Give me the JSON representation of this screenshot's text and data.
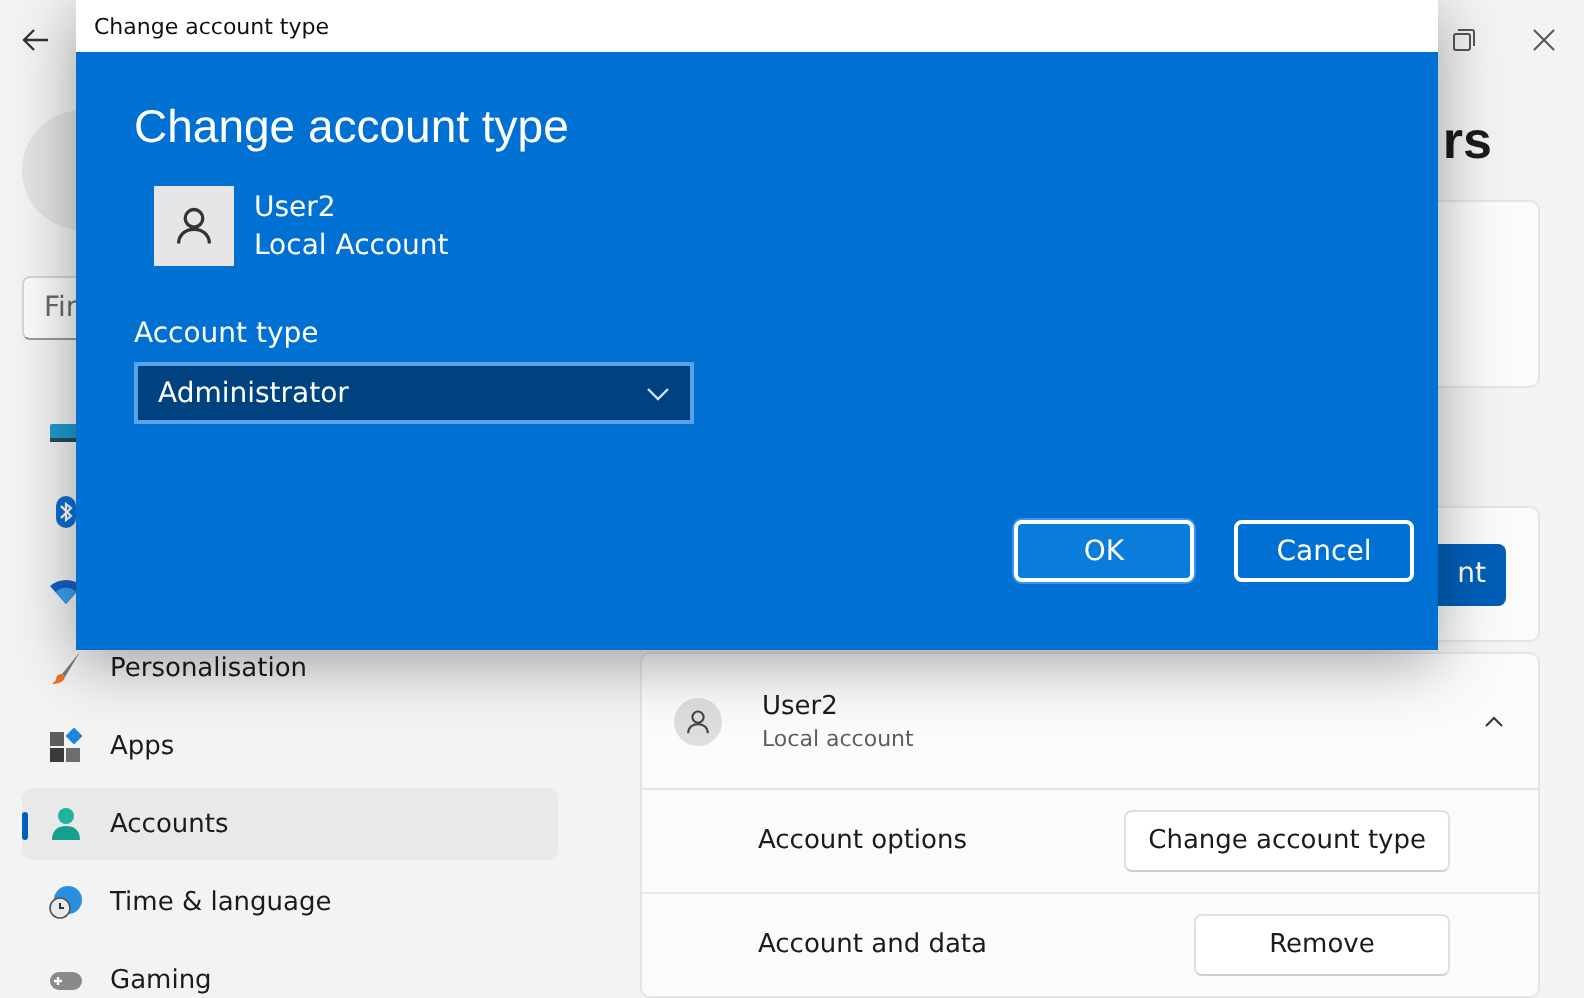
{
  "search": {
    "placeholder": "Fin"
  },
  "sidebar": {
    "items": [
      {
        "kind": "system",
        "selected": false
      },
      {
        "kind": "bluetooth",
        "selected": false
      },
      {
        "kind": "network",
        "selected": false
      },
      {
        "kind": "personalisation",
        "label": "Personalisation",
        "selected": false
      },
      {
        "kind": "apps",
        "label": "Apps",
        "selected": false
      },
      {
        "kind": "accounts",
        "label": "Accounts",
        "selected": true
      },
      {
        "kind": "time",
        "label": "Time & language",
        "selected": false
      },
      {
        "kind": "gaming",
        "label": "Gaming",
        "selected": false
      }
    ]
  },
  "page_heading": "rs",
  "add_account_button": "nt",
  "user_card": {
    "name": "User2",
    "subtitle": "Local account",
    "expanded": true,
    "options": [
      {
        "label": "Account options",
        "button": "Change account type"
      },
      {
        "label": "Account and data",
        "button": "Remove"
      }
    ]
  },
  "dialog": {
    "title": "Change account type",
    "heading": "Change account type",
    "user_name": "User2",
    "user_type": "Local Account",
    "field_label": "Account type",
    "value": "Administrator",
    "buttons": [
      {
        "label": "OK",
        "focused": true
      },
      {
        "label": "Cancel",
        "focused": false
      }
    ]
  }
}
